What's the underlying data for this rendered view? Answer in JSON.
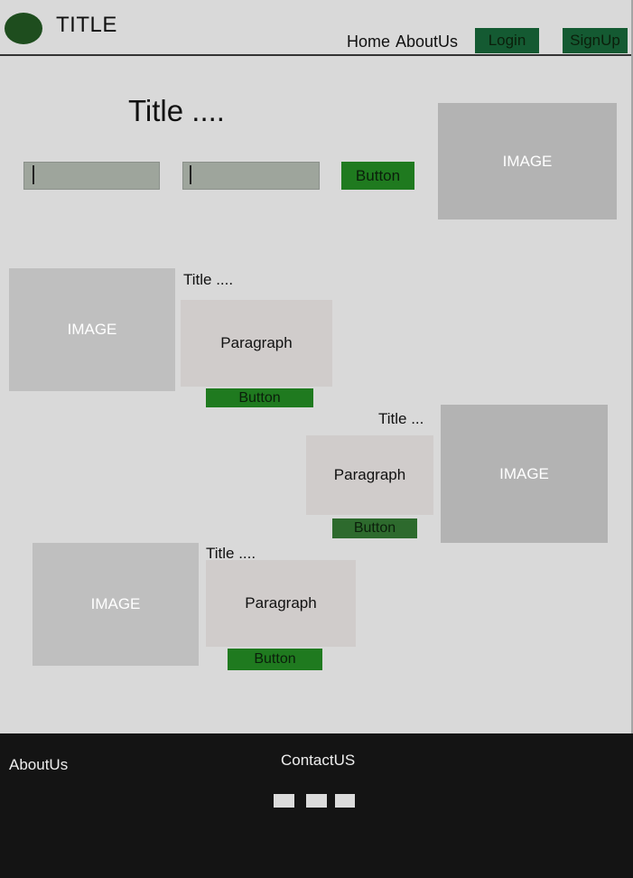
{
  "header": {
    "title": "TITLE",
    "nav": {
      "home": "Home",
      "about": "AboutUs"
    },
    "login_label": "Login",
    "signup_label": "SignUp",
    "logo_icon": "logo-oval-icon",
    "colors": {
      "background": "#d9d9d9",
      "logo": "#1e4d1e",
      "header_button": "#145a32"
    }
  },
  "hero": {
    "title": "Title ....",
    "input1_value": "",
    "input2_value": "",
    "button_label": "Button",
    "image_label": "IMAGE",
    "colors": {
      "input": "#9ea59c",
      "button": "#1f7a1f"
    }
  },
  "sections": [
    {
      "title": "Title ....",
      "paragraph": "Paragraph",
      "button_label": "Button",
      "image_label": "IMAGE"
    },
    {
      "title": "Title ...",
      "paragraph": "Paragraph",
      "button_label": "Button",
      "image_label": "IMAGE"
    },
    {
      "title": "Title ....",
      "paragraph": "Paragraph",
      "button_label": "Button",
      "image_label": "IMAGE"
    }
  ],
  "footer": {
    "about": "AboutUs",
    "contact": "ContactUS",
    "social_icons": [
      "social-icon-1",
      "social-icon-2",
      "social-icon-3"
    ],
    "colors": {
      "background": "#141414",
      "text": "#eeeeee"
    }
  }
}
